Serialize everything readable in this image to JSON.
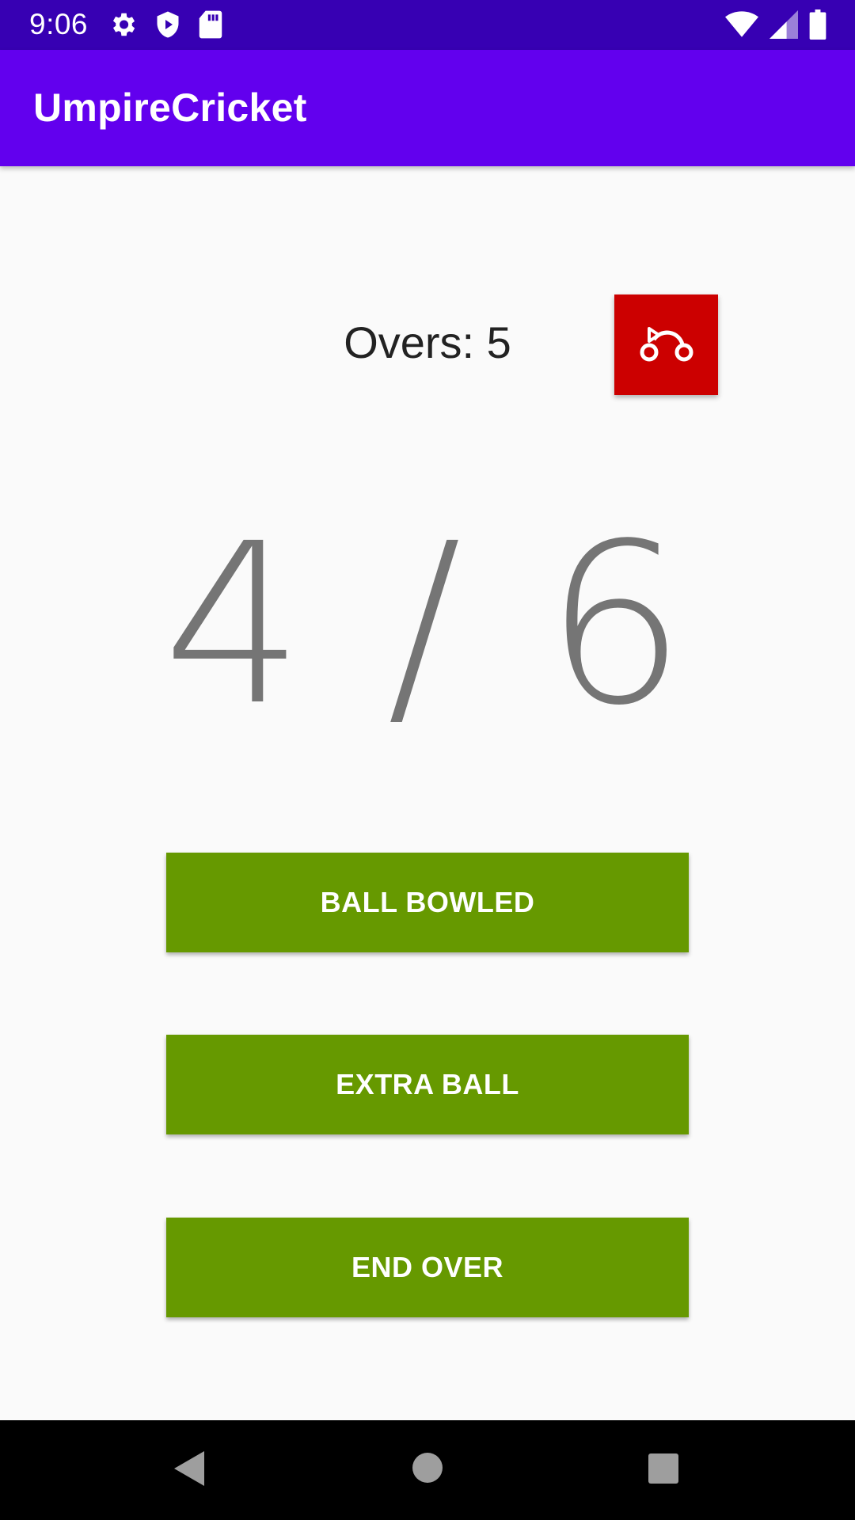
{
  "status_bar": {
    "time": "9:06",
    "icons_left": [
      "settings-icon",
      "shield-play-icon",
      "sd-card-icon"
    ],
    "icons_right": [
      "wifi-icon",
      "signal-icon",
      "battery-icon"
    ]
  },
  "app_bar": {
    "title": "UmpireCricket",
    "color": "#6200ee"
  },
  "main": {
    "overs_label": "Overs: 5",
    "undo_icon": "undo-icon",
    "ball_count": "4 / 6",
    "buttons": {
      "ball_bowled": "BALL BOWLED",
      "extra_ball": "EXTRA BALL",
      "end_over": "END OVER"
    },
    "button_color": "#669900",
    "undo_color": "#cc0000"
  },
  "nav_bar": {
    "buttons": [
      "back-icon",
      "home-icon",
      "recents-icon"
    ]
  }
}
